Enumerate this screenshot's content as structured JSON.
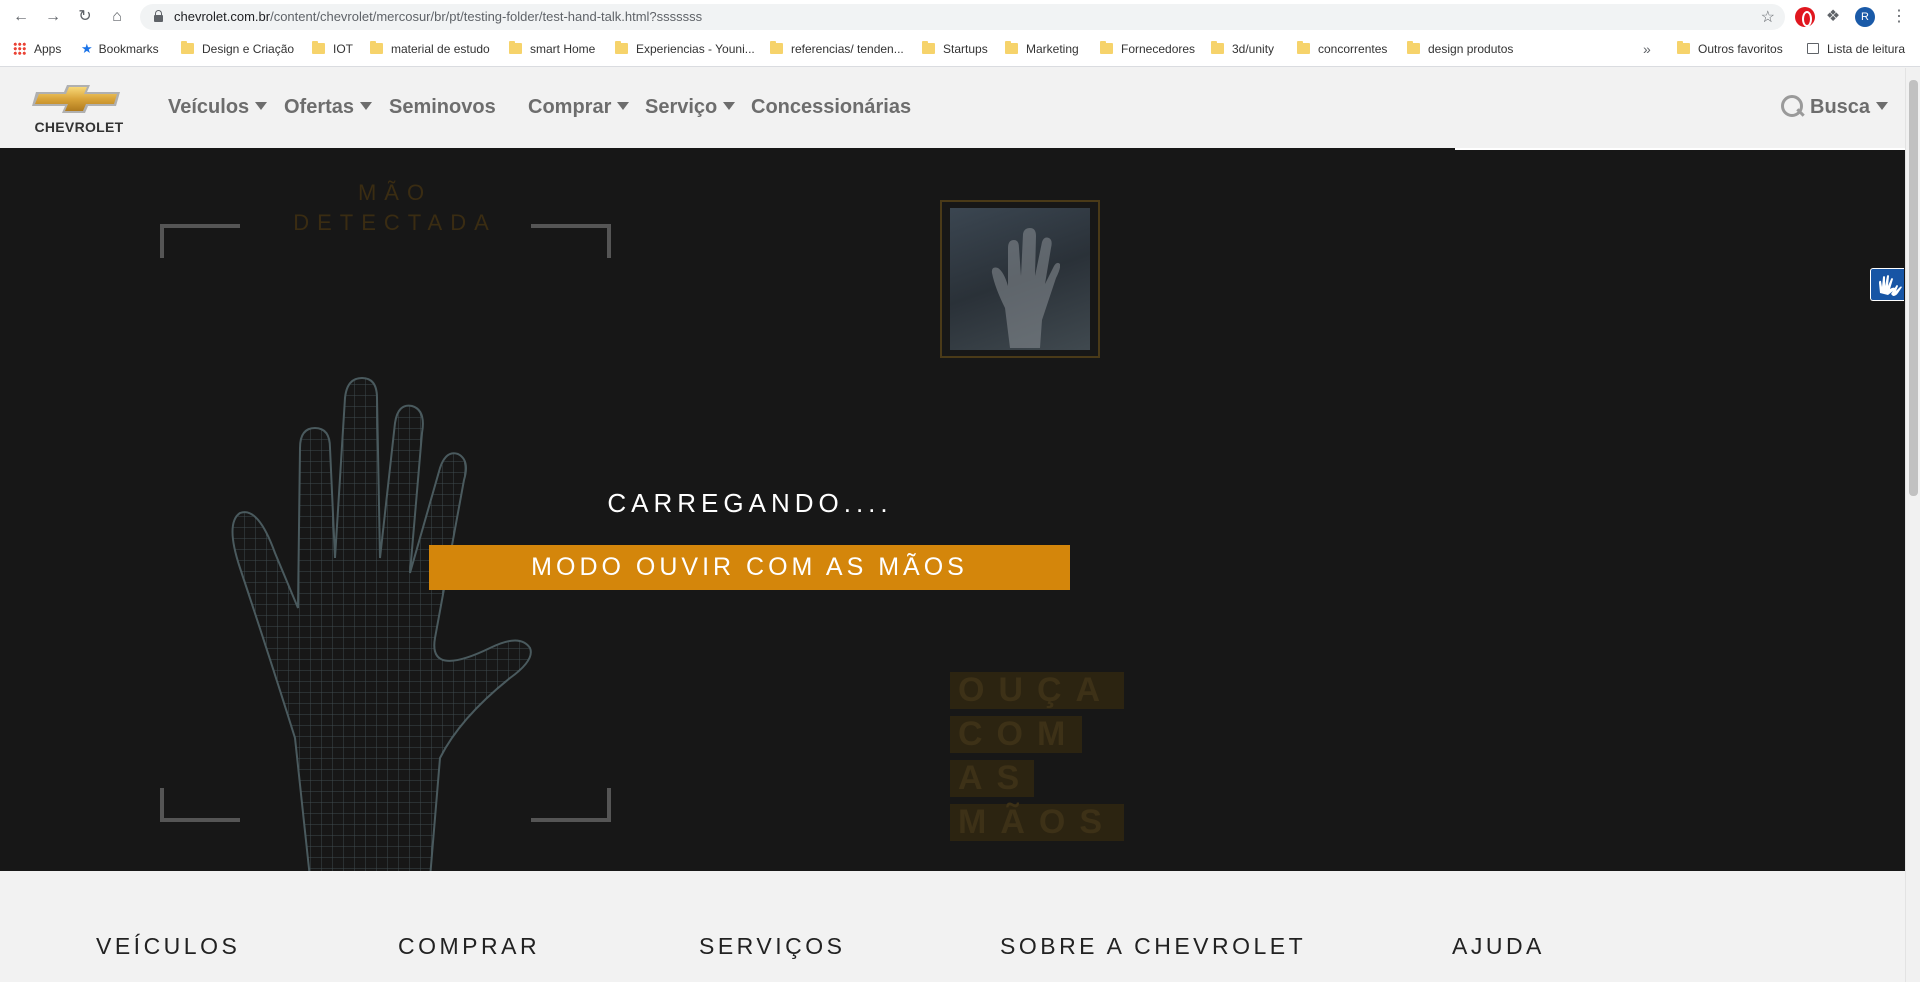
{
  "browser": {
    "url_host": "chevrolet.com.br",
    "url_path": "/content/chevrolet/mercosur/br/pt/testing-folder/test-hand-talk.html?sssssss",
    "avatar_letter": "R",
    "bookmarks": [
      {
        "label": "Apps"
      },
      {
        "label": "Bookmarks"
      },
      {
        "label": "Design e Criação"
      },
      {
        "label": "IOT"
      },
      {
        "label": "material de estudo"
      },
      {
        "label": "smart Home"
      },
      {
        "label": "Experiencias - Youni..."
      },
      {
        "label": "referencias/ tenden..."
      },
      {
        "label": "Startups"
      },
      {
        "label": "Marketing"
      },
      {
        "label": "Fornecedores"
      },
      {
        "label": "3d/unity"
      },
      {
        "label": "concorrentes"
      },
      {
        "label": "design produtos"
      }
    ],
    "overflow": "»",
    "other_bookmarks": "Outros favoritos",
    "reading_list": "Lista de leitura"
  },
  "header": {
    "logo_text": "CHEVROLET",
    "nav": [
      {
        "label": "Veículos",
        "dropdown": true
      },
      {
        "label": "Ofertas",
        "dropdown": true
      },
      {
        "label": "Seminovos",
        "dropdown": false
      },
      {
        "label": "Comprar",
        "dropdown": true
      },
      {
        "label": "Serviço",
        "dropdown": true
      },
      {
        "label": "Concessionárias",
        "dropdown": false
      }
    ],
    "search_label": "Busca"
  },
  "hero": {
    "hand_detected_line1": "MÃO",
    "hand_detected_line2": "DETECTADA",
    "loading_text": "CARREGANDO....",
    "mode_button": "MODO OUVIR COM AS MÃOS",
    "listen_lines": [
      "OUÇA",
      "COM",
      "AS",
      "MÃOS"
    ]
  },
  "footer": {
    "columns": [
      "VEÍCULOS",
      "COMPRAR",
      "SERVIÇOS",
      "SOBRE A CHEVROLET",
      "AJUDA"
    ]
  },
  "colors": {
    "accent": "#d4860b",
    "hero_bg": "#171717",
    "hand_talk_blue": "#1755a5"
  }
}
